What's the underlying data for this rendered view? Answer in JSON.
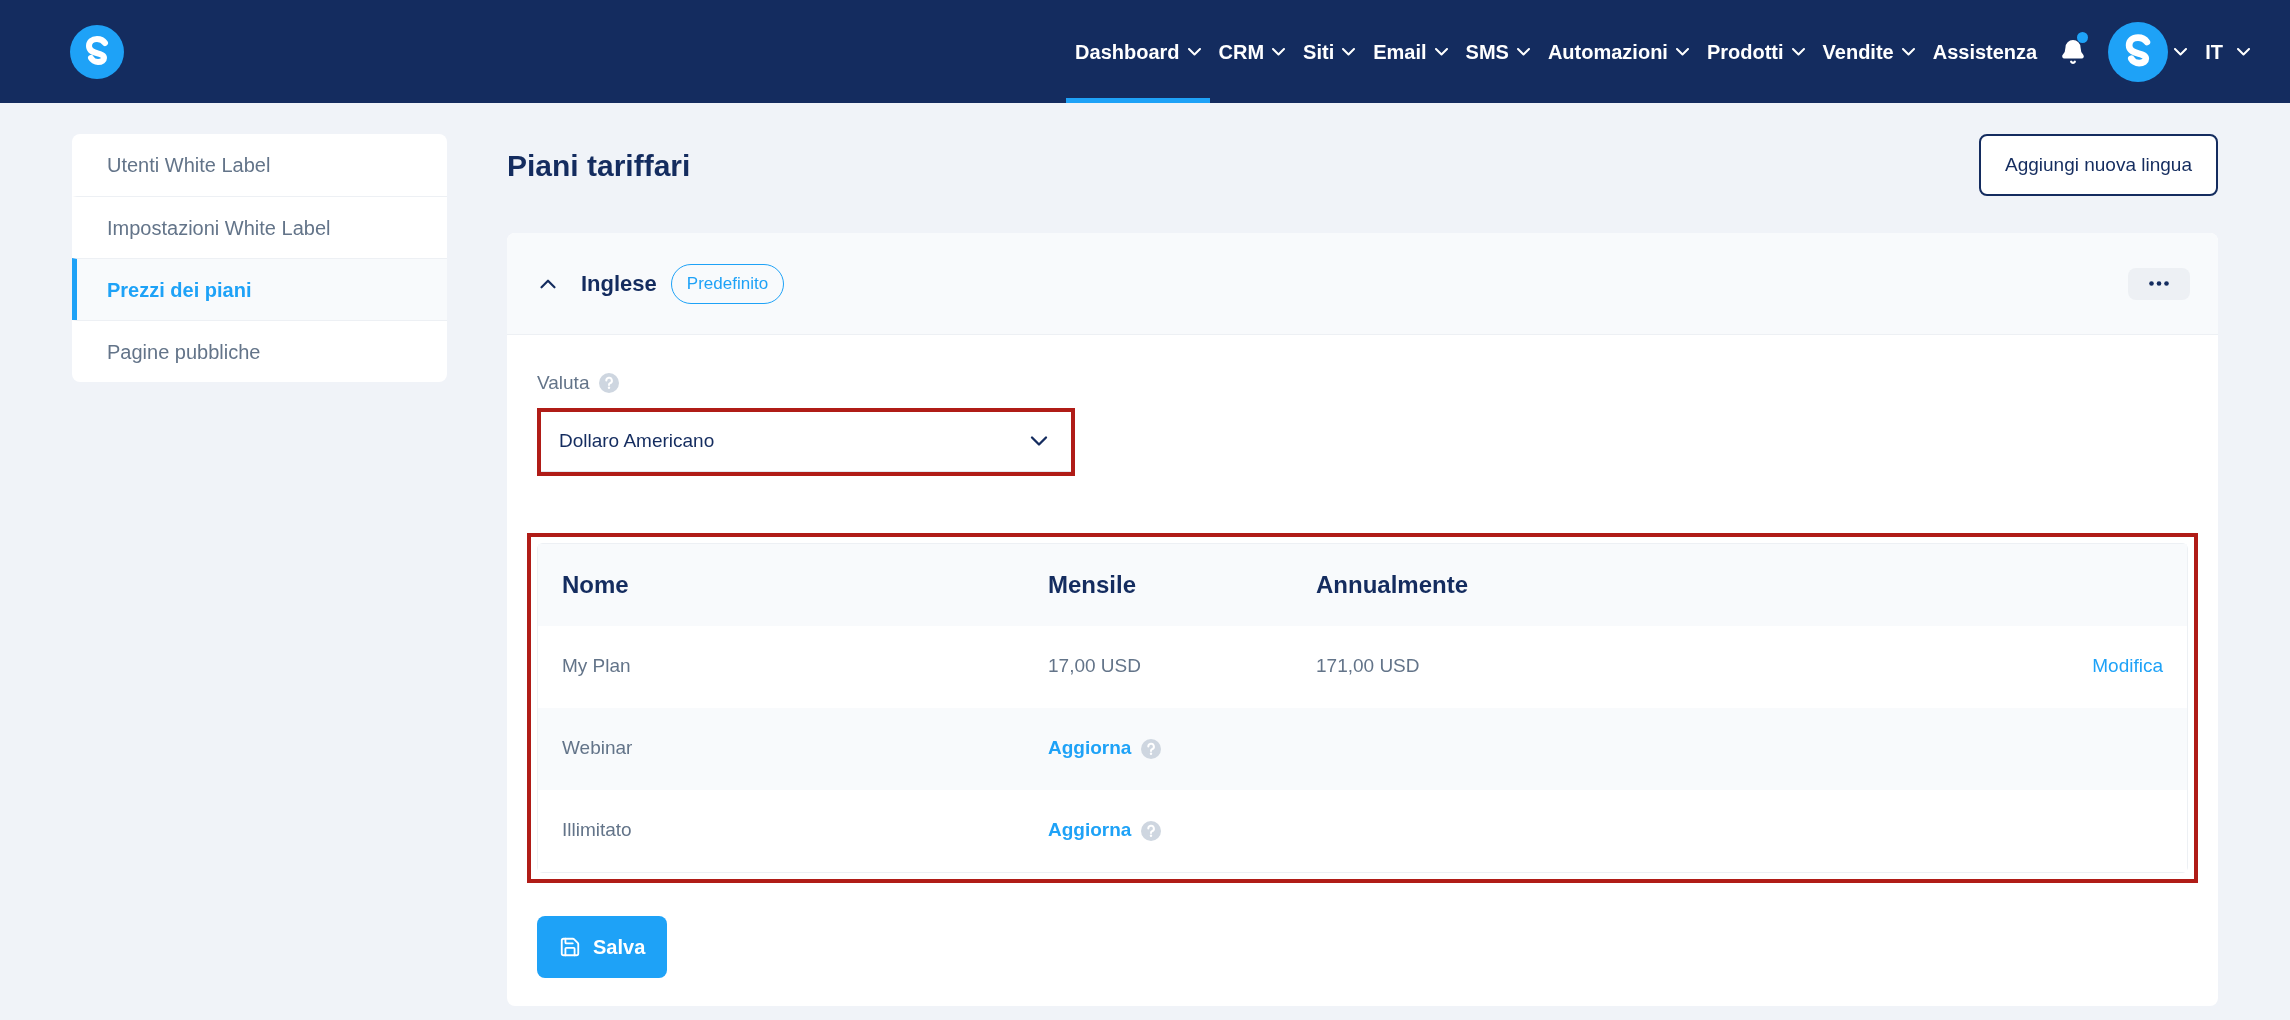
{
  "nav": {
    "items": [
      {
        "label": "Dashboard",
        "selected": true,
        "dropdown": true
      },
      {
        "label": "CRM",
        "selected": false,
        "dropdown": true
      },
      {
        "label": "Siti",
        "selected": false,
        "dropdown": true
      },
      {
        "label": "Email",
        "selected": false,
        "dropdown": true
      },
      {
        "label": "SMS",
        "selected": false,
        "dropdown": true
      },
      {
        "label": "Automazioni",
        "selected": false,
        "dropdown": true
      },
      {
        "label": "Prodotti",
        "selected": false,
        "dropdown": true
      },
      {
        "label": "Vendite",
        "selected": false,
        "dropdown": true
      },
      {
        "label": "Assistenza",
        "selected": false,
        "dropdown": false
      }
    ],
    "notifications": {
      "unread": true
    },
    "language": "IT"
  },
  "sidebar": {
    "items": [
      {
        "label": "Utenti White Label",
        "selected": false
      },
      {
        "label": "Impostazioni White Label",
        "selected": false
      },
      {
        "label": "Prezzi dei piani",
        "selected": true
      },
      {
        "label": "Pagine pubbliche",
        "selected": false
      }
    ]
  },
  "page": {
    "title": "Piani tariffari",
    "add_button": "Aggiungi nuova lingua"
  },
  "language_panel": {
    "name": "Inglese",
    "badge": "Predefinito",
    "expanded": true,
    "currency": {
      "label": "Valuta",
      "value": "Dollaro Americano"
    },
    "table": {
      "columns": [
        "Nome",
        "Mensile",
        "Annualmente"
      ],
      "rows": [
        {
          "name": "My Plan",
          "monthly": {
            "kind": "text",
            "text": "17,00 USD"
          },
          "yearly": "171,00 USD",
          "action": "Modifica"
        },
        {
          "name": "Webinar",
          "monthly": {
            "kind": "link",
            "text": "Aggiorna"
          }
        },
        {
          "name": "Illimitato",
          "monthly": {
            "kind": "link",
            "text": "Aggiorna"
          }
        }
      ]
    },
    "save_button": "Salva"
  }
}
